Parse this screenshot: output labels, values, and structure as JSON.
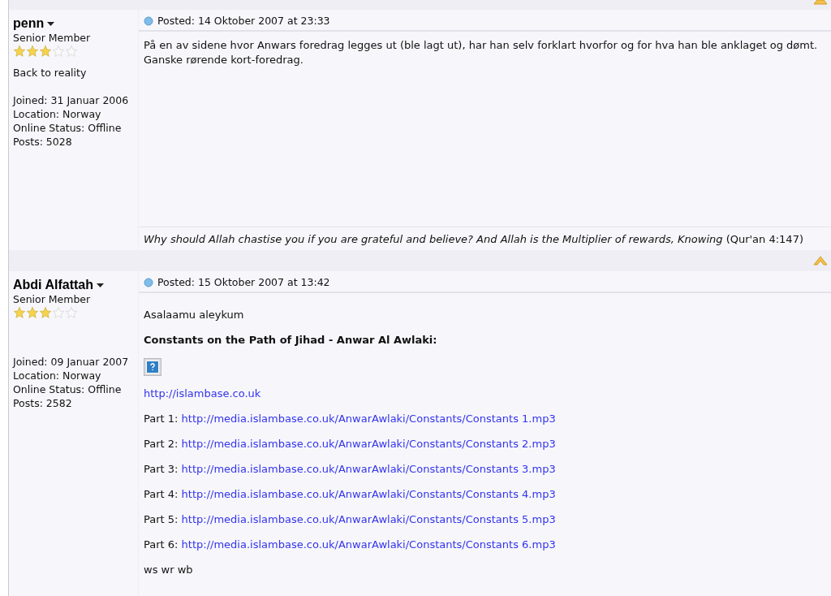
{
  "posts": [
    {
      "author": "penn",
      "rank": "Senior Member",
      "stars": 3,
      "tagline": "Back to reality",
      "details": [
        "Joined: 31 Januar 2006",
        "Location: Norway",
        "Online Status: Offline",
        "Posts: 5028"
      ],
      "posted": "Posted: 14 Oktober 2007 at 23:33",
      "body": [
        {
          "kind": "text",
          "text": "På en av sidene hvor Anwars foredrag legges ut (ble lagt ut), har han selv forklart hvorfor og for hva han ble anklaget og dømt. Ganske rørende kort-foredrag."
        }
      ],
      "signature": "*Why should Allah chastise you if you are grateful and believe? And Allah is the Multiplier of rewards, Knowing* (Qur'an 4:147)"
    },
    {
      "author": "Abdi Alfattah",
      "rank": "Senior Member",
      "stars": 3,
      "details": [
        "Joined: 09 Januar 2007",
        "Location: Norway",
        "Online Status: Offline",
        "Posts: 2582"
      ],
      "posted": "Posted: 15 Oktober 2007 at 13:42",
      "body": [
        {
          "kind": "text",
          "text": "Asalaamu aleykum"
        },
        {
          "kind": "bold",
          "text": "Constants on the Path of Jihad - Anwar Al Awlaki:"
        },
        {
          "kind": "image"
        },
        {
          "kind": "link",
          "url": "http://islambase.co.uk"
        },
        {
          "kind": "part",
          "label": "Part 1:",
          "url": "http://media.islambase.co.uk/AnwarAwlaki/Constants/Constants 1.mp3"
        },
        {
          "kind": "part",
          "label": "Part 2:",
          "url": "http://media.islambase.co.uk/AnwarAwlaki/Constants/Constants 2.mp3"
        },
        {
          "kind": "part",
          "label": "Part 3:",
          "url": "http://media.islambase.co.uk/AnwarAwlaki/Constants/Constants 3.mp3"
        },
        {
          "kind": "part",
          "label": "Part 4:",
          "url": "http://media.islambase.co.uk/AnwarAwlaki/Constants/Constants 4.mp3"
        },
        {
          "kind": "part",
          "label": "Part 5:",
          "url": "http://media.islambase.co.uk/AnwarAwlaki/Constants/Constants 5.mp3"
        },
        {
          "kind": "part",
          "label": "Part 6:",
          "url": "http://media.islambase.co.uk/AnwarAwlaki/Constants/Constants 6.mp3"
        },
        {
          "kind": "text",
          "text": "ws wr wb"
        }
      ]
    }
  ]
}
